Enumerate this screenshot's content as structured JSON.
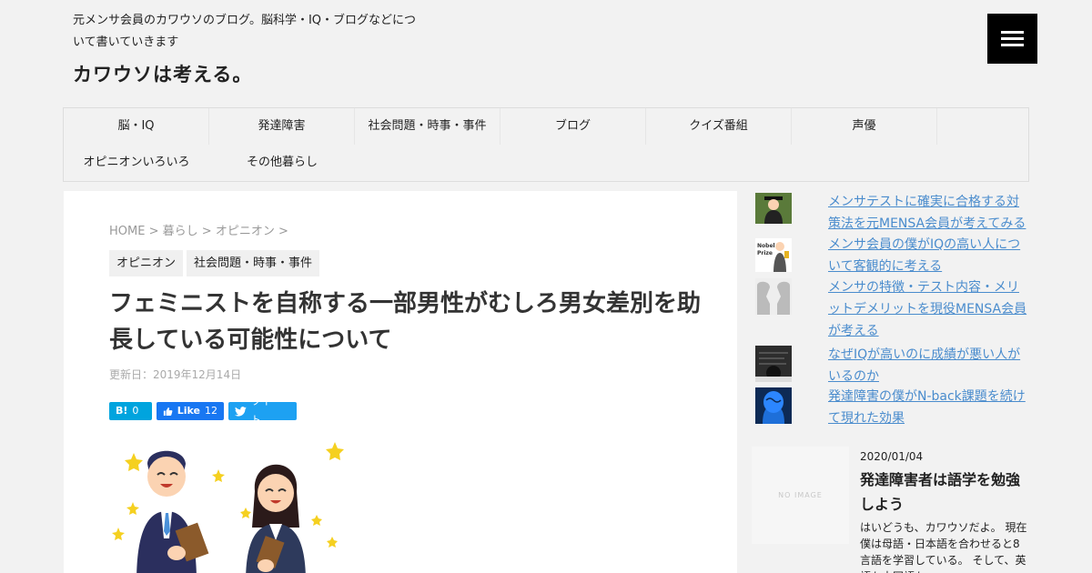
{
  "header": {
    "description": "元メンサ会員のカワウソのブログ。脳科学・IQ・ブログなどについて書いていきます",
    "title": "カワウソは考える。"
  },
  "nav": {
    "items": [
      "脳・IQ",
      "発達障害",
      "社会問題・時事・事件",
      "ブログ",
      "クイズ番組",
      "声優",
      "オピニオンいろいろ",
      "その他暮らし"
    ]
  },
  "breadcrumb": {
    "home": "HOME",
    "sep": ">",
    "level1": "暮らし",
    "level2": "オピニオン"
  },
  "article": {
    "categories": [
      "オピニオン",
      "社会問題・時事・事件"
    ],
    "title": "フェミニストを自称する一部男性がむしろ男女差別を助長している可能性について",
    "updated": "更新日：2019年12月14日",
    "share": {
      "hatena_label": "B!",
      "hatena_count": "0",
      "fb_label": "Like",
      "fb_count": "12",
      "tweet_label": "ツイート"
    }
  },
  "sidebar": {
    "popular": [
      {
        "title": "メンサテストに確実に合格する対策法を元MENSA会員が考えてみる",
        "thumb": "graduation-thumb"
      },
      {
        "title": "メンサ会員の僕がIQの高い人について客観的に考える",
        "thumb": "nobel-prize-thumb"
      },
      {
        "title": "メンサの特徴・テスト内容・メリットデメリットを現役MENSA会員が考える",
        "thumb": "faces-thumb"
      },
      {
        "title": "なぜIQが高いのに成績が悪い人がいるのか",
        "thumb": "exam-thumb"
      },
      {
        "title": "発達障害の僕がN-back課題を続けて現れた効果",
        "thumb": "brain-thumb"
      }
    ],
    "recent": {
      "noimage_label": "NO IMAGE",
      "date": "2020/01/04",
      "title": "発達障害者は語学を勉強しよう",
      "excerpt": "はいどうも、カワウソだよ。 現在僕は母語・日本語を合わせると8言語を学習している。 そして、英語も中国語も"
    }
  },
  "colors": {
    "link": "#4a8ccd",
    "hatena": "#00a4de",
    "facebook": "#1877f2",
    "twitter": "#1da1f2"
  }
}
